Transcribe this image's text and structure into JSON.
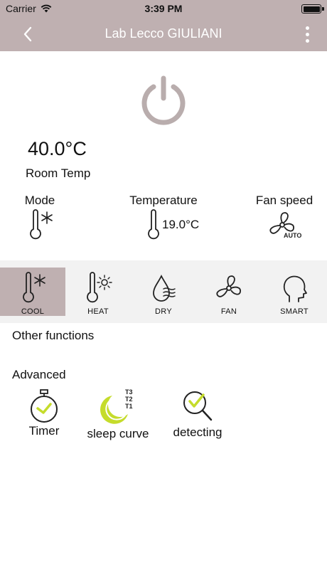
{
  "status_bar": {
    "carrier": "Carrier",
    "time": "3:39 PM"
  },
  "nav": {
    "title": "Lab Lecco GIULIANI"
  },
  "room": {
    "temperature": "40.0°C",
    "label": "Room Temp"
  },
  "status": {
    "mode_label": "Mode",
    "temperature_label": "Temperature",
    "set_temperature": "19.0°C",
    "fan_label": "Fan speed",
    "fan_value": "AUTO"
  },
  "modes": [
    {
      "label": "COOL",
      "icon": "thermometer-snowflake-icon",
      "active": true
    },
    {
      "label": "HEAT",
      "icon": "thermometer-sun-icon",
      "active": false
    },
    {
      "label": "DRY",
      "icon": "drop-waves-icon",
      "active": false
    },
    {
      "label": "FAN",
      "icon": "fan-icon",
      "active": false
    },
    {
      "label": "SMART",
      "icon": "head-profile-icon",
      "active": false
    }
  ],
  "sections": {
    "other": "Other functions",
    "advanced": "Advanced"
  },
  "advanced": [
    {
      "label": "Timer",
      "icon": "stopwatch-icon"
    },
    {
      "label": "sleep curve",
      "icon": "moon-icon",
      "badges": [
        "T3",
        "T2",
        "T1"
      ]
    },
    {
      "label": "detecting",
      "icon": "magnifier-check-icon"
    }
  ],
  "colors": {
    "header": "#bfb0b1",
    "accent": "#c5dc2b",
    "icon": "#222222",
    "power": "#b9adad"
  }
}
